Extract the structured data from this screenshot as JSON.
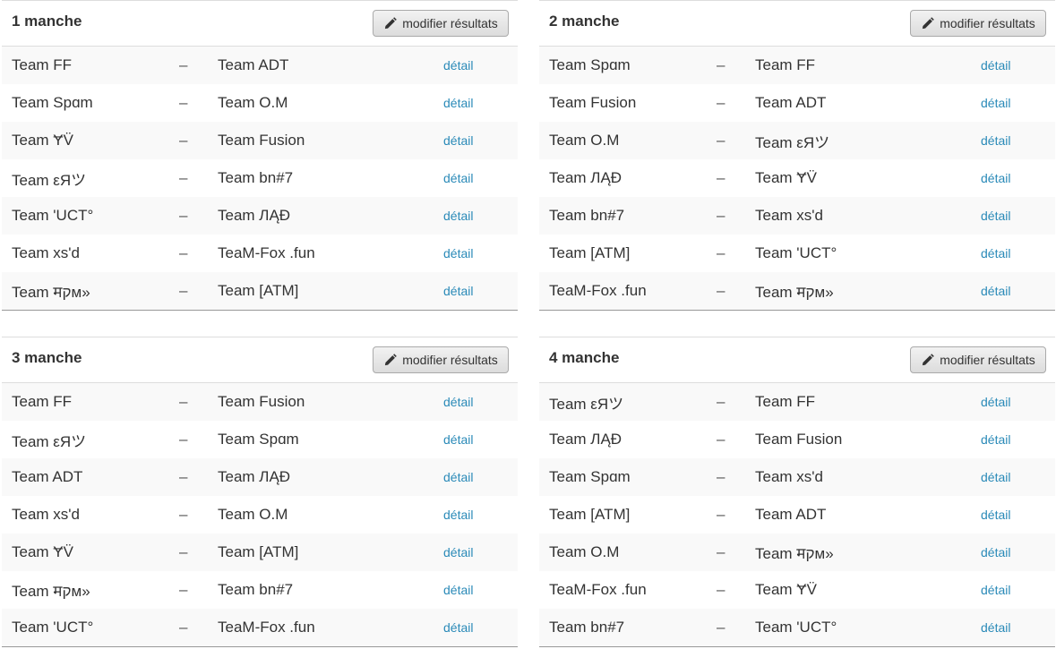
{
  "rounds": [
    {
      "title": "1 manche",
      "edit_label": "modifier résultats",
      "matches": [
        {
          "home": "Team FF",
          "sep": "–",
          "away": "Team ADT",
          "link": "détail"
        },
        {
          "home": "Team Spɑm",
          "sep": "–",
          "away": "Team O.M",
          "link": "détail"
        },
        {
          "home": "Team ɎV̈",
          "sep": "–",
          "away": "Team Fusion",
          "link": "détail"
        },
        {
          "home": "Team εЯツ",
          "sep": "–",
          "away": "Team bn#7",
          "link": "détail"
        },
        {
          "home": "Team 'UCT°",
          "sep": "–",
          "away": "Team ЛĄÐ",
          "link": "détail"
        },
        {
          "home": "Team xs'd",
          "sep": "–",
          "away": "TeaM-Fox .fun",
          "link": "détail"
        },
        {
          "home": "Team मקм»",
          "sep": "–",
          "away": "Team [ATM]",
          "link": "détail"
        }
      ]
    },
    {
      "title": "2 manche",
      "edit_label": "modifier résultats",
      "matches": [
        {
          "home": "Team Spɑm",
          "sep": "–",
          "away": "Team FF",
          "link": "détail"
        },
        {
          "home": "Team Fusion",
          "sep": "–",
          "away": "Team ADT",
          "link": "détail"
        },
        {
          "home": "Team O.M",
          "sep": "–",
          "away": "Team εЯツ",
          "link": "détail"
        },
        {
          "home": "Team ЛĄÐ",
          "sep": "–",
          "away": "Team ɎV̈",
          "link": "détail"
        },
        {
          "home": "Team bn#7",
          "sep": "–",
          "away": "Team xs'd",
          "link": "détail"
        },
        {
          "home": "Team [ATM]",
          "sep": "–",
          "away": "Team 'UCT°",
          "link": "détail"
        },
        {
          "home": "TeaM-Fox .fun",
          "sep": "–",
          "away": "Team मקм»",
          "link": "détail"
        }
      ]
    },
    {
      "title": "3 manche",
      "edit_label": "modifier résultats",
      "matches": [
        {
          "home": "Team FF",
          "sep": "–",
          "away": "Team Fusion",
          "link": "détail"
        },
        {
          "home": "Team εЯツ",
          "sep": "–",
          "away": "Team Spɑm",
          "link": "détail"
        },
        {
          "home": "Team ADT",
          "sep": "–",
          "away": "Team ЛĄÐ",
          "link": "détail"
        },
        {
          "home": "Team xs'd",
          "sep": "–",
          "away": "Team O.M",
          "link": "détail"
        },
        {
          "home": "Team ɎV̈",
          "sep": "–",
          "away": "Team [ATM]",
          "link": "détail"
        },
        {
          "home": "Team मקм»",
          "sep": "–",
          "away": "Team bn#7",
          "link": "détail"
        },
        {
          "home": "Team 'UCT°",
          "sep": "–",
          "away": "TeaM-Fox .fun",
          "link": "détail"
        }
      ]
    },
    {
      "title": "4 manche",
      "edit_label": "modifier résultats",
      "matches": [
        {
          "home": "Team εЯツ",
          "sep": "–",
          "away": "Team FF",
          "link": "détail"
        },
        {
          "home": "Team ЛĄÐ",
          "sep": "–",
          "away": "Team Fusion",
          "link": "détail"
        },
        {
          "home": "Team Spɑm",
          "sep": "–",
          "away": "Team xs'd",
          "link": "détail"
        },
        {
          "home": "Team [ATM]",
          "sep": "–",
          "away": "Team ADT",
          "link": "détail"
        },
        {
          "home": "Team O.M",
          "sep": "–",
          "away": "Team मקм»",
          "link": "détail"
        },
        {
          "home": "TeaM-Fox .fun",
          "sep": "–",
          "away": "Team ɎV̈",
          "link": "détail"
        },
        {
          "home": "Team bn#7",
          "sep": "–",
          "away": "Team 'UCT°",
          "link": "détail"
        }
      ]
    }
  ],
  "icons": {
    "edit": "pencil-icon"
  },
  "colors": {
    "link": "#2a8ab8",
    "stripe": "#f9f9f9",
    "text": "#333333"
  }
}
